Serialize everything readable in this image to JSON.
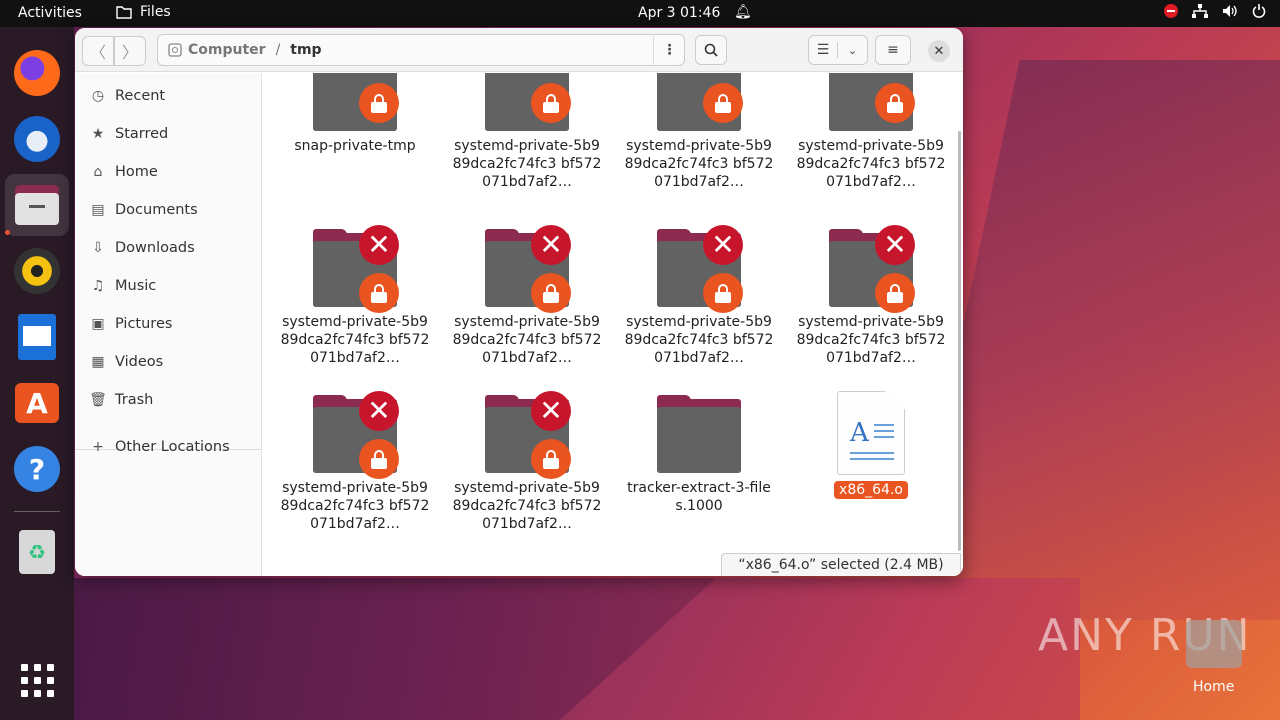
{
  "topbar": {
    "activities": "Activities",
    "app_name": "Files",
    "clock": "Apr 3  01:46"
  },
  "window": {
    "path": [
      "Computer",
      "/",
      "tmp"
    ],
    "status": "“x86_64.o” selected  (2.4 MB)"
  },
  "sidebar": {
    "items": [
      {
        "label": "Recent",
        "icon": "clock-icon"
      },
      {
        "label": "Starred",
        "icon": "star-icon"
      },
      {
        "label": "Home",
        "icon": "home-icon"
      },
      {
        "label": "Documents",
        "icon": "document-icon"
      },
      {
        "label": "Downloads",
        "icon": "download-icon"
      },
      {
        "label": "Music",
        "icon": "music-icon"
      },
      {
        "label": "Pictures",
        "icon": "picture-icon"
      },
      {
        "label": "Videos",
        "icon": "video-icon"
      },
      {
        "label": "Trash",
        "icon": "trash-icon"
      },
      {
        "label": "Other Locations",
        "icon": "plus-icon"
      }
    ]
  },
  "files": [
    {
      "name": "snap-private-tmp",
      "lock": true,
      "error": false
    },
    {
      "name": "systemd-private-5b989dca2fc74fc3 bf572071bd7af2…",
      "lock": true,
      "error": false
    },
    {
      "name": "systemd-private-5b989dca2fc74fc3 bf572071bd7af2…",
      "lock": true,
      "error": false
    },
    {
      "name": "systemd-private-5b989dca2fc74fc3 bf572071bd7af2…",
      "lock": true,
      "error": false
    },
    {
      "name": "systemd-private-5b989dca2fc74fc3 bf572071bd7af2…",
      "lock": true,
      "error": true
    },
    {
      "name": "systemd-private-5b989dca2fc74fc3 bf572071bd7af2…",
      "lock": true,
      "error": true
    },
    {
      "name": "systemd-private-5b989dca2fc74fc3 bf572071bd7af2…",
      "lock": true,
      "error": true
    },
    {
      "name": "systemd-private-5b989dca2fc74fc3 bf572071bd7af2…",
      "lock": true,
      "error": true
    },
    {
      "name": "systemd-private-5b989dca2fc74fc3 bf572071bd7af2…",
      "lock": true,
      "error": true
    },
    {
      "name": "systemd-private-5b989dca2fc74fc3 bf572071bd7af2…",
      "lock": true,
      "error": true
    },
    {
      "name": "tracker-extract-3-files.1000",
      "lock": false,
      "error": false
    },
    {
      "name": "x86_64.o",
      "lock": false,
      "error": false,
      "type": "document",
      "selected": true
    }
  ],
  "desktop": {
    "watermark": "ANY RUN",
    "home_label": "Home"
  },
  "colors": {
    "accent": "#e95420",
    "error": "#c7162b",
    "folder_tab": "#8c2b50",
    "folder_body": "#626262"
  }
}
